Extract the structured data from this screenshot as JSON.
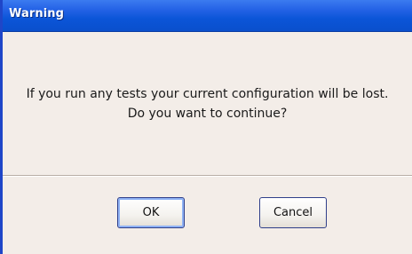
{
  "dialog": {
    "title": "Warning",
    "message_line1": "If you run any tests your current configuration will be lost.",
    "message_line2": "Do you want to continue?",
    "ok_label": "OK",
    "cancel_label": "Cancel"
  },
  "colors": {
    "titlebar": "#0b55d8",
    "background": "#f3ede8",
    "title_text": "#ffffff"
  }
}
